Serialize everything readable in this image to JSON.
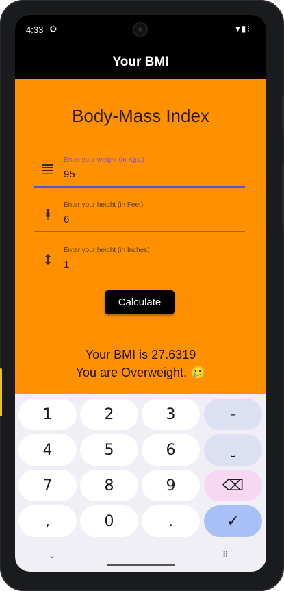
{
  "status_bar": {
    "time": "4:33",
    "left_icon": "settings-gear-icon",
    "right_icons": [
      "wifi-icon",
      "battery-icon",
      "dots-icon"
    ]
  },
  "app_bar": {
    "title": "Your BMI"
  },
  "main": {
    "heading": "Body-Mass Index",
    "fields": [
      {
        "icon": "weight-lines-icon",
        "label": "Enter your weight (in Kgs.)",
        "value": "95",
        "active": true
      },
      {
        "icon": "person-icon",
        "label": "Enter your height (in Feet)",
        "value": "6",
        "active": false
      },
      {
        "icon": "vertical-arrows-icon",
        "label": "Enter your height (in Inches)",
        "value": "1",
        "active": false
      }
    ],
    "calculate_label": "Calculate",
    "result_line1": "Your BMI is 27.6319",
    "result_line2": "You are Overweight. 🥲"
  },
  "keyboard": {
    "keys": [
      {
        "label": "1"
      },
      {
        "label": "2"
      },
      {
        "label": "3"
      },
      {
        "label": "–"
      },
      {
        "label": "4"
      },
      {
        "label": "5"
      },
      {
        "label": "6"
      },
      {
        "label": "⎵"
      },
      {
        "label": "7"
      },
      {
        "label": "8"
      },
      {
        "label": "9"
      },
      {
        "label": "⌫"
      },
      {
        "label": ","
      },
      {
        "label": "0"
      },
      {
        "label": "."
      },
      {
        "label": "✓"
      }
    ],
    "nav_left": "⌄",
    "nav_right": "⠿"
  },
  "colors": {
    "accent": "#ff9100",
    "app_bar": "#000000",
    "active_underline": "#5b4fd8"
  }
}
